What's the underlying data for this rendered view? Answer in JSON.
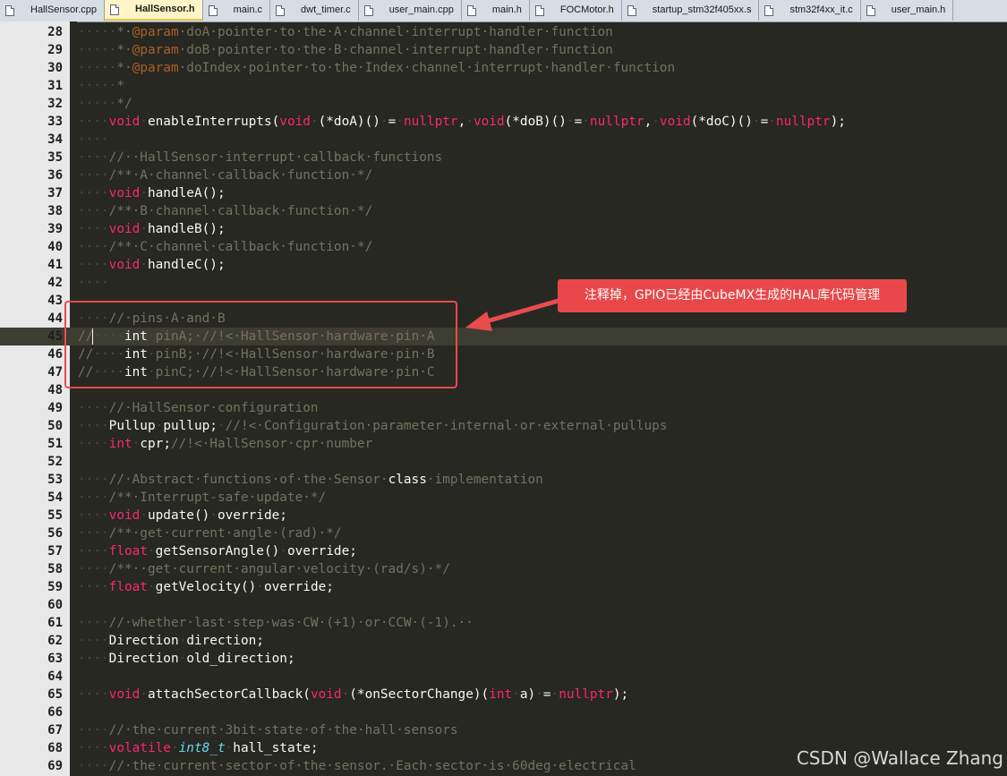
{
  "tabs": [
    {
      "label": "HallSensor.cpp",
      "active": false
    },
    {
      "label": "HallSensor.h",
      "active": true
    },
    {
      "label": "main.c",
      "active": false
    },
    {
      "label": "dwt_timer.c",
      "active": false
    },
    {
      "label": "user_main.cpp",
      "active": false
    },
    {
      "label": "main.h",
      "active": false
    },
    {
      "label": "FOCMotor.h",
      "active": false
    },
    {
      "label": "startup_stm32f405xx.s",
      "active": false
    },
    {
      "label": "stm32f4xx_it.c",
      "active": false
    },
    {
      "label": "user_main.h",
      "active": false
    }
  ],
  "current_line": 45,
  "lines": [
    {
      "n": 28,
      "segs": [
        [
          "ws",
          "·····"
        ],
        [
          "cm",
          "*·"
        ],
        [
          "tag",
          "@param"
        ],
        [
          "cm",
          "·doA·pointer·to·the·A·channel·interrupt·handler·function"
        ]
      ]
    },
    {
      "n": 29,
      "segs": [
        [
          "ws",
          "·····"
        ],
        [
          "cm",
          "*·"
        ],
        [
          "tag",
          "@param"
        ],
        [
          "cm",
          "·doB·pointer·to·the·B·channel·interrupt·handler·function"
        ]
      ]
    },
    {
      "n": 30,
      "segs": [
        [
          "ws",
          "·····"
        ],
        [
          "cm",
          "*·"
        ],
        [
          "tag",
          "@param"
        ],
        [
          "cm",
          "·doIndex·pointer·to·the·Index·channel·interrupt·handler·function"
        ]
      ]
    },
    {
      "n": 31,
      "segs": [
        [
          "ws",
          "·····"
        ],
        [
          "cm",
          "*"
        ]
      ]
    },
    {
      "n": 32,
      "segs": [
        [
          "ws",
          "·····"
        ],
        [
          "cm",
          "*/"
        ]
      ]
    },
    {
      "n": 33,
      "segs": [
        [
          "ws",
          "····"
        ],
        [
          "kw",
          "void"
        ],
        [
          "ws",
          "·"
        ],
        [
          "pl",
          "enableInterrupts("
        ],
        [
          "kw",
          "void"
        ],
        [
          "ws",
          "·"
        ],
        [
          "pl",
          "(*doA)()"
        ],
        [
          "ws",
          "·"
        ],
        [
          "pl",
          "="
        ],
        [
          "ws",
          "·"
        ],
        [
          "kw",
          "nullptr"
        ],
        [
          "pl",
          ","
        ],
        [
          "ws",
          "·"
        ],
        [
          "kw",
          "void"
        ],
        [
          "pl",
          "(*doB)()"
        ],
        [
          "ws",
          "·"
        ],
        [
          "pl",
          "="
        ],
        [
          "ws",
          "·"
        ],
        [
          "kw",
          "nullptr"
        ],
        [
          "pl",
          ","
        ],
        [
          "ws",
          "·"
        ],
        [
          "kw",
          "void"
        ],
        [
          "pl",
          "(*doC)()"
        ],
        [
          "ws",
          "·"
        ],
        [
          "pl",
          "="
        ],
        [
          "ws",
          "·"
        ],
        [
          "kw",
          "nullptr"
        ],
        [
          "pl",
          ");"
        ]
      ]
    },
    {
      "n": 34,
      "segs": [
        [
          "ws",
          "····"
        ]
      ]
    },
    {
      "n": 35,
      "segs": [
        [
          "ws",
          "····"
        ],
        [
          "cm",
          "//··HallSensor·interrupt·callback·functions"
        ]
      ]
    },
    {
      "n": 36,
      "segs": [
        [
          "ws",
          "····"
        ],
        [
          "cm",
          "/**·A·channel·callback·function·*/"
        ]
      ]
    },
    {
      "n": 37,
      "segs": [
        [
          "ws",
          "····"
        ],
        [
          "kw",
          "void"
        ],
        [
          "ws",
          "·"
        ],
        [
          "pl",
          "handleA();"
        ]
      ]
    },
    {
      "n": 38,
      "segs": [
        [
          "ws",
          "····"
        ],
        [
          "cm",
          "/**·B·channel·callback·function·*/"
        ]
      ]
    },
    {
      "n": 39,
      "segs": [
        [
          "ws",
          "····"
        ],
        [
          "kw",
          "void"
        ],
        [
          "ws",
          "·"
        ],
        [
          "pl",
          "handleB();"
        ]
      ]
    },
    {
      "n": 40,
      "segs": [
        [
          "ws",
          "····"
        ],
        [
          "cm",
          "/**·C·channel·callback·function·*/"
        ]
      ]
    },
    {
      "n": 41,
      "segs": [
        [
          "ws",
          "····"
        ],
        [
          "kw",
          "void"
        ],
        [
          "ws",
          "·"
        ],
        [
          "pl",
          "handleC();"
        ]
      ]
    },
    {
      "n": 42,
      "segs": [
        [
          "ws",
          "····"
        ]
      ]
    },
    {
      "n": 43,
      "segs": []
    },
    {
      "n": 44,
      "segs": [
        [
          "ws",
          "····"
        ],
        [
          "cm",
          "//·pins·A·and·B"
        ]
      ]
    },
    {
      "n": 45,
      "segs": [
        [
          "cm",
          "//"
        ],
        [
          "ws",
          "····"
        ],
        [
          "pl",
          "int"
        ],
        [
          "ws",
          "·"
        ],
        [
          "cm",
          "pinA;·//!<·HallSensor·hardware·pin·A"
        ]
      ]
    },
    {
      "n": 46,
      "segs": [
        [
          "cm",
          "//"
        ],
        [
          "ws",
          "····"
        ],
        [
          "pl",
          "int"
        ],
        [
          "ws",
          "·"
        ],
        [
          "cm",
          "pinB;·//!<·HallSensor·hardware·pin·B"
        ]
      ]
    },
    {
      "n": 47,
      "segs": [
        [
          "cm",
          "//"
        ],
        [
          "ws",
          "····"
        ],
        [
          "pl",
          "int"
        ],
        [
          "ws",
          "·"
        ],
        [
          "cm",
          "pinC;·//!<·HallSensor·hardware·pin·C"
        ]
      ]
    },
    {
      "n": 48,
      "segs": []
    },
    {
      "n": 49,
      "segs": [
        [
          "ws",
          "····"
        ],
        [
          "cm",
          "//·HallSensor·configuration"
        ]
      ]
    },
    {
      "n": 50,
      "segs": [
        [
          "ws",
          "····"
        ],
        [
          "pl",
          "Pullup"
        ],
        [
          "ws",
          "·"
        ],
        [
          "pl",
          "pullup;"
        ],
        [
          "ws",
          "·"
        ],
        [
          "cm",
          "//!<·Configuration·parameter·internal·or·external·pullups"
        ]
      ]
    },
    {
      "n": 51,
      "segs": [
        [
          "ws",
          "····"
        ],
        [
          "kw",
          "int"
        ],
        [
          "ws",
          "·"
        ],
        [
          "pl",
          "cpr;"
        ],
        [
          "cm",
          "//!<·HallSensor·cpr·number"
        ]
      ]
    },
    {
      "n": 52,
      "segs": []
    },
    {
      "n": 53,
      "segs": [
        [
          "ws",
          "····"
        ],
        [
          "cm",
          "//·Abstract·functions·of·the·Sensor·"
        ],
        [
          "pl",
          "class"
        ],
        [
          "cm",
          "·implementation"
        ]
      ]
    },
    {
      "n": 54,
      "segs": [
        [
          "ws",
          "····"
        ],
        [
          "cm",
          "/**·Interrupt-safe·update·*/"
        ]
      ]
    },
    {
      "n": 55,
      "segs": [
        [
          "ws",
          "····"
        ],
        [
          "kw",
          "void"
        ],
        [
          "ws",
          "·"
        ],
        [
          "pl",
          "update()"
        ],
        [
          "ws",
          "·"
        ],
        [
          "pl",
          "override;"
        ]
      ]
    },
    {
      "n": 56,
      "segs": [
        [
          "ws",
          "····"
        ],
        [
          "cm",
          "/**·get·current·angle·(rad)·*/"
        ]
      ]
    },
    {
      "n": 57,
      "segs": [
        [
          "ws",
          "····"
        ],
        [
          "kw",
          "float"
        ],
        [
          "ws",
          "·"
        ],
        [
          "pl",
          "getSensorAngle()"
        ],
        [
          "ws",
          "·"
        ],
        [
          "pl",
          "override;"
        ]
      ]
    },
    {
      "n": 58,
      "segs": [
        [
          "ws",
          "····"
        ],
        [
          "cm",
          "/**··get·current·angular·velocity·(rad/s)·*/"
        ]
      ]
    },
    {
      "n": 59,
      "segs": [
        [
          "ws",
          "····"
        ],
        [
          "kw",
          "float"
        ],
        [
          "ws",
          "·"
        ],
        [
          "pl",
          "getVelocity()"
        ],
        [
          "ws",
          "·"
        ],
        [
          "pl",
          "override;"
        ]
      ]
    },
    {
      "n": 60,
      "segs": []
    },
    {
      "n": 61,
      "segs": [
        [
          "ws",
          "····"
        ],
        [
          "cm",
          "//·whether·last·step·was·CW·(+1)·or·CCW·(-1).··"
        ]
      ]
    },
    {
      "n": 62,
      "segs": [
        [
          "ws",
          "····"
        ],
        [
          "pl",
          "Direction"
        ],
        [
          "ws",
          "·"
        ],
        [
          "pl",
          "direction;"
        ]
      ]
    },
    {
      "n": 63,
      "segs": [
        [
          "ws",
          "····"
        ],
        [
          "pl",
          "Direction"
        ],
        [
          "ws",
          "·"
        ],
        [
          "pl",
          "old_direction;"
        ]
      ]
    },
    {
      "n": 64,
      "segs": []
    },
    {
      "n": 65,
      "segs": [
        [
          "ws",
          "····"
        ],
        [
          "kw",
          "void"
        ],
        [
          "ws",
          "·"
        ],
        [
          "pl",
          "attachSectorCallback("
        ],
        [
          "kw",
          "void"
        ],
        [
          "ws",
          "·"
        ],
        [
          "pl",
          "(*onSectorChange)("
        ],
        [
          "kw",
          "int"
        ],
        [
          "ws",
          "·"
        ],
        [
          "pl",
          "a)"
        ],
        [
          "ws",
          "·"
        ],
        [
          "pl",
          "="
        ],
        [
          "ws",
          "·"
        ],
        [
          "kw",
          "nullptr"
        ],
        [
          "pl",
          ");"
        ]
      ]
    },
    {
      "n": 66,
      "segs": []
    },
    {
      "n": 67,
      "segs": [
        [
          "ws",
          "····"
        ],
        [
          "cm",
          "//·the·current·3bit·state·of·the·hall·sensors"
        ]
      ]
    },
    {
      "n": 68,
      "segs": [
        [
          "ws",
          "····"
        ],
        [
          "kw",
          "volatile"
        ],
        [
          "ws",
          "·"
        ],
        [
          "ty",
          "int8_t"
        ],
        [
          "ws",
          "·"
        ],
        [
          "pl",
          "hall_state;"
        ]
      ]
    },
    {
      "n": 69,
      "segs": [
        [
          "ws",
          "····"
        ],
        [
          "cm",
          "//·the·current·sector·of·the·sensor.·Each·sector·is·60deg·electrical"
        ]
      ]
    }
  ],
  "annotation": {
    "callout_text": "注释掉，GPIO已经由CubeMX生成的HAL库代码管理",
    "color": "#e8484a"
  },
  "watermark": "CSDN @Wallace Zhang",
  "colors": {
    "background": "#272822",
    "keyword": "#f92672",
    "comment": "#75715e",
    "type": "#66d9ef",
    "plain": "#f8f8f2",
    "doc_tag": "#aa5f2a"
  }
}
